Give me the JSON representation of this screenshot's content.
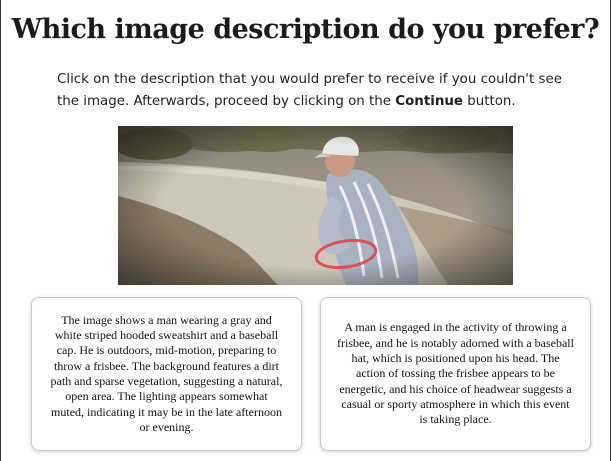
{
  "page": {
    "title": "Which image description do you prefer?",
    "instructions_part1": "Click on the description that you would prefer to receive if you couldn't see the image. Afterwards, proceed by clicking on the ",
    "instructions_bold": "Continue",
    "instructions_part2": " button."
  },
  "descriptions": [
    {
      "text": "The image shows a man wearing a gray and white striped hooded sweatshirt and a baseball cap. He is outdoors, mid-motion, preparing to throw a frisbee. The background features a dirt path and sparse vegetation, suggesting a natural, open area. The lighting appears somewhat muted, indicating it may be in the late afternoon or evening."
    },
    {
      "text": "A man is engaged in the activity of throwing a frisbee, and he is notably adorned with a baseball hat, which is positioned upon his head. The action of tossing the frisbee appears to be energetic, and his choice of headwear suggests a casual or sporty atmosphere in which this event is taking place."
    }
  ],
  "colors": {
    "frisbee": "#e0444d",
    "hoodie": "#a9b2bf",
    "cap": "#e8e8e8"
  }
}
